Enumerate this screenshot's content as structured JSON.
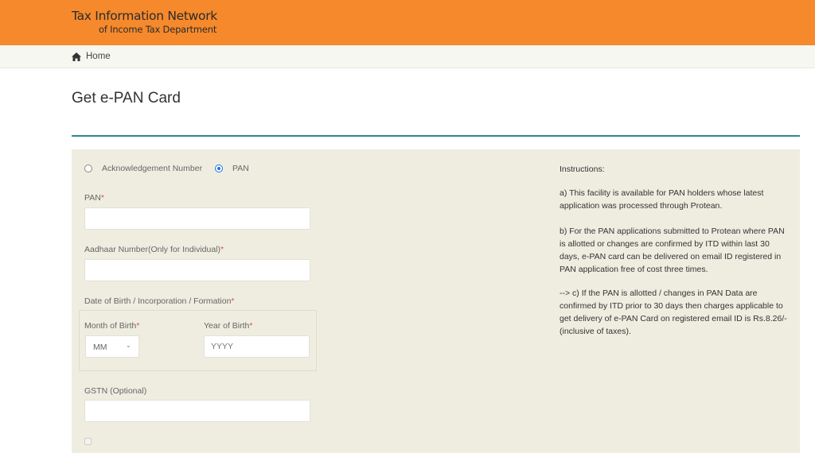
{
  "header": {
    "logo_line1": "Tax Information Network",
    "logo_line2": "of Income Tax Department",
    "brand_color": "#f5892c"
  },
  "breadcrumb": {
    "icon": "home-icon",
    "home_label": "Home"
  },
  "page": {
    "title": "Get e-PAN Card",
    "accent_color": "#2a8a96"
  },
  "form": {
    "radio_options": [
      {
        "label": "Acknowledgement Number",
        "selected": false
      },
      {
        "label": "PAN",
        "selected": true
      }
    ],
    "pan_label": "PAN",
    "pan_value": "",
    "aadhaar_label": "Aadhaar Number(Only for Individual)",
    "aadhaar_value": "",
    "dob_label": "Date of Birth / Incorporation / Formation",
    "month_label": "Month of Birth",
    "month_selected": "MM",
    "year_label": "Year of Birth",
    "year_placeholder": "YYYY",
    "gstn_label": "GSTN (Optional)",
    "gstn_value": "",
    "required_mark": "*",
    "consent_checked": false
  },
  "instructions": {
    "heading": "Instructions:",
    "items": [
      "a) This facility is available for PAN holders whose latest application was processed through Protean.",
      "b) For the PAN applications submitted to Protean where PAN is allotted or changes are confirmed by ITD within last 30 days, e-PAN card can be delivered on email ID registered in PAN application free of cost three times.",
      "--> c) If the PAN is allotted / changes in PAN Data are confirmed by ITD prior to 30 days then charges applicable to get delivery of e-PAN Card on registered email ID is Rs.8.26/- (inclusive of taxes)."
    ]
  }
}
